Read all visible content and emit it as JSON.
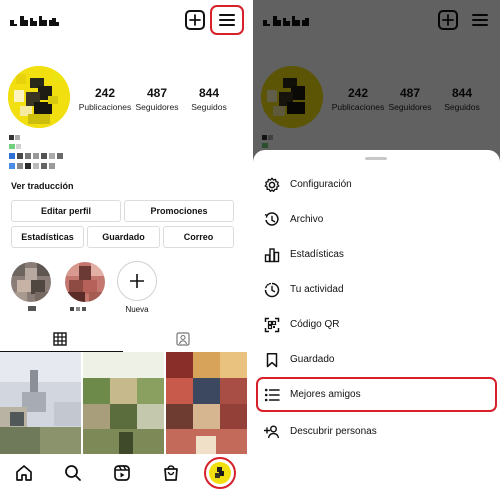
{
  "profile": {
    "stats": [
      {
        "value": "242",
        "label": "Publicaciones"
      },
      {
        "value": "487",
        "label": "Seguidores"
      },
      {
        "value": "844",
        "label": "Seguidos"
      }
    ],
    "see_translation": "Ver traducción",
    "buttons": {
      "edit_profile": "Editar perfil",
      "promotions": "Promociones",
      "insights": "Estadísticas",
      "saved": "Guardado",
      "email": "Correo"
    },
    "new_highlight_label": "Nueva"
  },
  "menu": {
    "items": [
      {
        "label": "Configuración",
        "icon": "settings-icon"
      },
      {
        "label": "Archivo",
        "icon": "archive-icon"
      },
      {
        "label": "Estadísticas",
        "icon": "insights-icon"
      },
      {
        "label": "Tu actividad",
        "icon": "activity-icon"
      },
      {
        "label": "Código QR",
        "icon": "qr-code-icon"
      },
      {
        "label": "Guardado",
        "icon": "bookmark-icon"
      },
      {
        "label": "Mejores amigos",
        "icon": "close-friends-list-icon"
      },
      {
        "label": "Descubrir personas",
        "icon": "add-person-icon"
      }
    ]
  },
  "colors": {
    "highlight": "#d6202a",
    "avatar_yellow": "#f1df10",
    "overlay": "rgba(0,0,0,0.62)"
  }
}
